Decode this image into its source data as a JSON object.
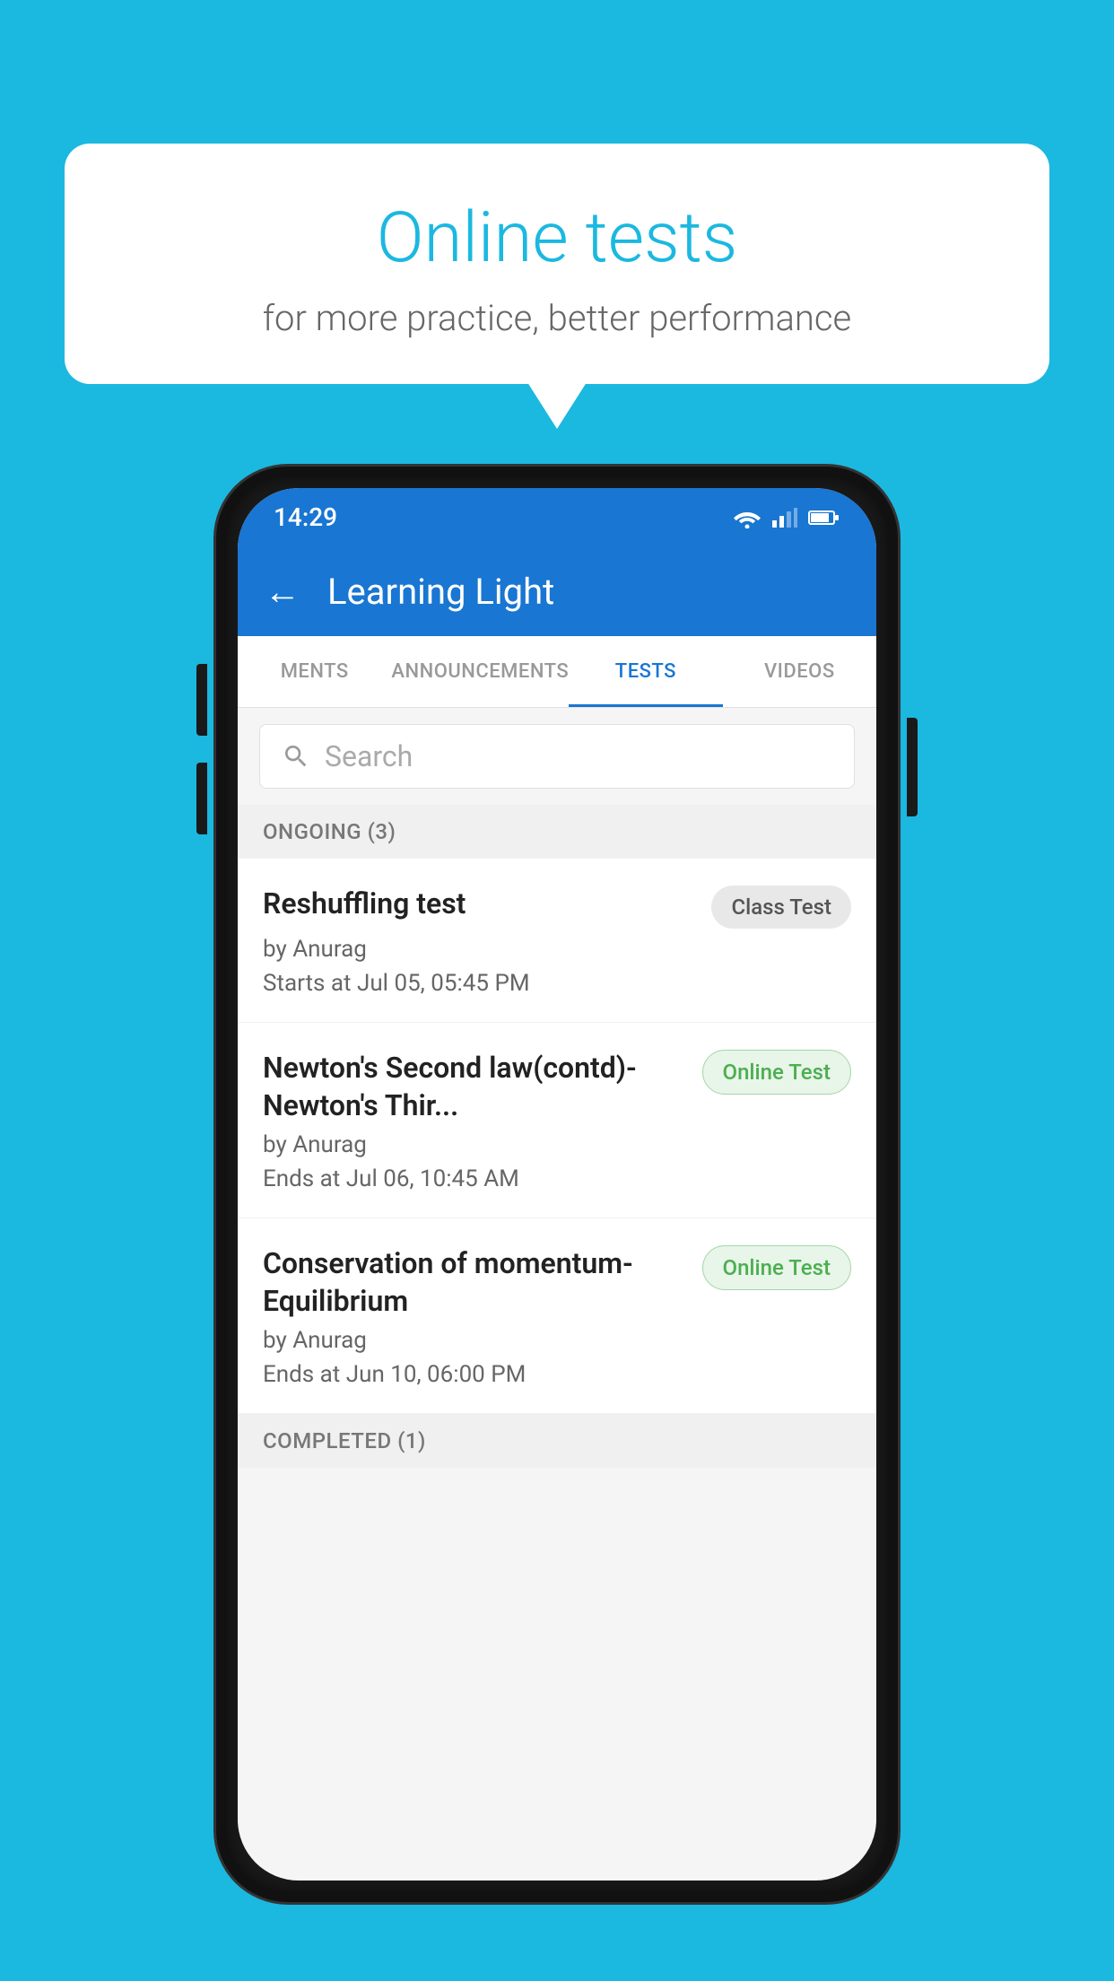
{
  "background": {
    "color": "#1BB8E0"
  },
  "speech_bubble": {
    "title": "Online tests",
    "subtitle": "for more practice, better performance"
  },
  "phone": {
    "status_bar": {
      "time": "14:29",
      "icons": [
        "wifi",
        "signal",
        "battery"
      ]
    },
    "app_bar": {
      "title": "Learning Light",
      "back_label": "←"
    },
    "tabs": [
      {
        "label": "MENTS",
        "active": false
      },
      {
        "label": "ANNOUNCEMENTS",
        "active": false
      },
      {
        "label": "TESTS",
        "active": true
      },
      {
        "label": "VIDEOS",
        "active": false
      }
    ],
    "search": {
      "placeholder": "Search"
    },
    "sections": [
      {
        "header": "ONGOING (3)",
        "tests": [
          {
            "title": "Reshuffling test",
            "badge_text": "Class Test",
            "badge_type": "class",
            "author": "by Anurag",
            "time_label": "Starts at  Jul 05, 05:45 PM"
          },
          {
            "title": "Newton's Second law(contd)-Newton's Thir...",
            "badge_text": "Online Test",
            "badge_type": "online",
            "author": "by Anurag",
            "time_label": "Ends at  Jul 06, 10:45 AM"
          },
          {
            "title": "Conservation of momentum-Equilibrium",
            "badge_text": "Online Test",
            "badge_type": "online",
            "author": "by Anurag",
            "time_label": "Ends at  Jun 10, 06:00 PM"
          }
        ]
      },
      {
        "header": "COMPLETED (1)",
        "tests": []
      }
    ]
  }
}
